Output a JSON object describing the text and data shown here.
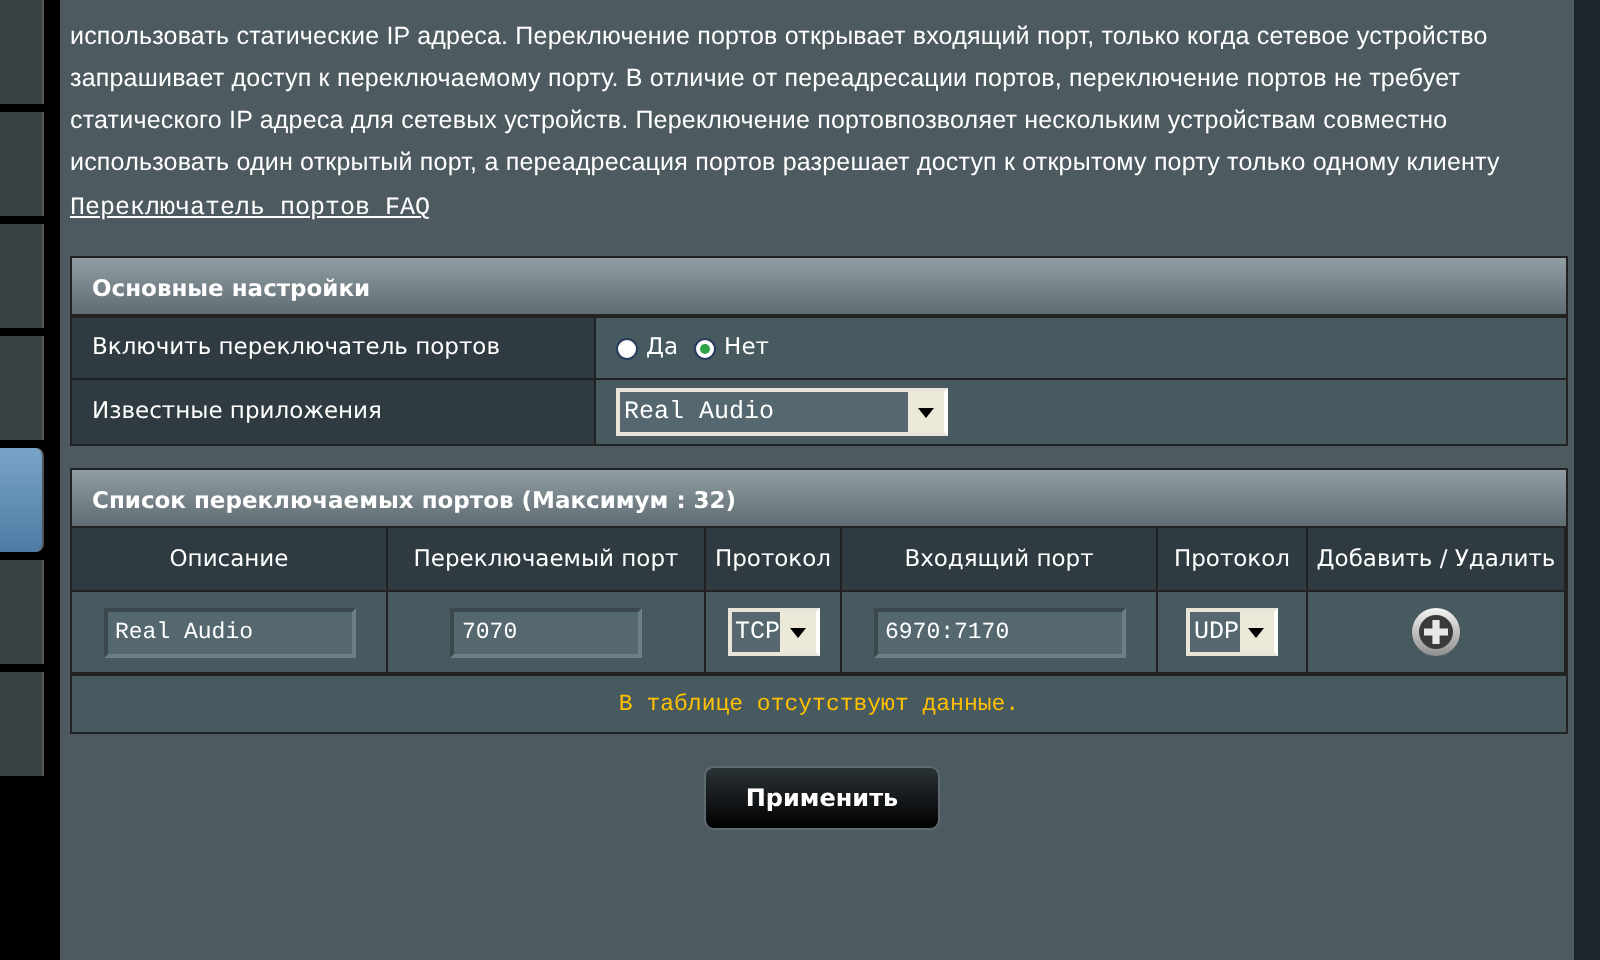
{
  "sidebar": {
    "items": [
      {
        "selected": false
      },
      {
        "selected": false
      },
      {
        "selected": false
      },
      {
        "selected": false
      },
      {
        "selected": true
      },
      {
        "selected": false
      },
      {
        "selected": false
      }
    ]
  },
  "intro": {
    "lines": [
      "использовать статические IP адреса. Переключение портов открывает входящий порт, только когда сетевое устройство",
      "запрашивает доступ к переключаемому порту. В отличие от переадресации портов, переключение портов не требует",
      "статического IP адреса для сетевых устройств. Переключение портовпозволяет нескольким устройствам совместно",
      "использовать один открытый порт, а переадресация портов разрешает доступ к открытому порту только одному клиенту"
    ],
    "link": "Переключатель портов FAQ"
  },
  "basic_settings": {
    "title": "Основные настройки",
    "rows": [
      {
        "kind": "radio",
        "label": "Включить переключатель портов",
        "options": [
          {
            "label": "Да",
            "selected": false
          },
          {
            "label": "Нет",
            "selected": true
          }
        ]
      },
      {
        "kind": "select",
        "label": "Известные приложения",
        "value": "Real Audio"
      }
    ]
  },
  "trigger_list": {
    "title": "Список переключаемых портов (Максимум : 32)",
    "columns": [
      "Описание",
      "Переключаемый порт",
      "Протокол",
      "Входящий порт",
      "Протокол",
      "Добавить / Удалить"
    ],
    "new_row": [
      {
        "kind": "input",
        "value": "Real Audio"
      },
      {
        "kind": "input",
        "value": "7070"
      },
      {
        "kind": "select",
        "value": "TCP"
      },
      {
        "kind": "input",
        "value": "6970:7170"
      },
      {
        "kind": "select",
        "value": "UDP"
      },
      {
        "kind": "add"
      }
    ],
    "empty_message": "В таблице отсутствуют данные."
  },
  "apply_button": "Применить"
}
